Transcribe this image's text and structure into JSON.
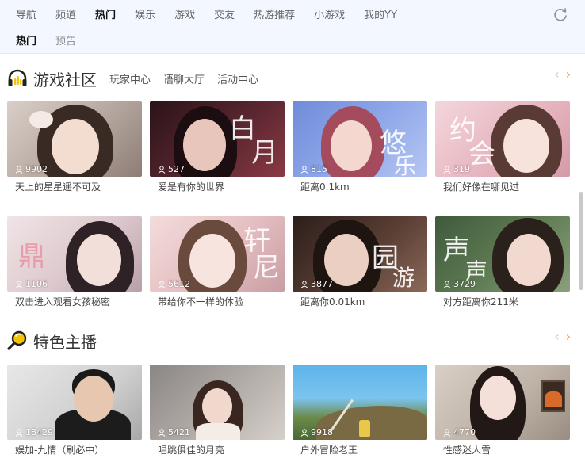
{
  "nav": {
    "tabs": [
      "导航",
      "频道",
      "热门",
      "娱乐",
      "游戏",
      "交友",
      "热游推荐",
      "小游戏",
      "我的YY"
    ],
    "active_tab": "热门",
    "subtabs": [
      "热门",
      "预告"
    ],
    "active_subtab": "热门"
  },
  "game_section": {
    "title": "游戏社区",
    "links": [
      "玩家中心",
      "语聊大厅",
      "活动中心"
    ],
    "cards": [
      {
        "viewers": "9902",
        "caption": "天上的星星遥不可及"
      },
      {
        "viewers": "527",
        "caption": "爱是有你的世界"
      },
      {
        "viewers": "815",
        "caption": "距离0.1km"
      },
      {
        "viewers": "319",
        "caption": "我们好像在哪见过"
      },
      {
        "viewers": "1106",
        "caption": "双击进入观看女孩秘密"
      },
      {
        "viewers": "5612",
        "caption": "带给你不一样的体验"
      },
      {
        "viewers": "3877",
        "caption": "距离你0.01km"
      },
      {
        "viewers": "3729",
        "caption": "对方距离你211米"
      }
    ]
  },
  "anchor_section": {
    "title": "特色主播",
    "cards": [
      {
        "viewers": "18429",
        "caption": "娱加-九情（刷必中）"
      },
      {
        "viewers": "5421",
        "caption": "唱跳俱佳的月亮"
      },
      {
        "viewers": "9918",
        "caption": "户外冒险老王"
      },
      {
        "viewers": "4770",
        "caption": "性感迷人雪"
      }
    ]
  },
  "thumb_overlay_text": [
    "白",
    "月",
    "悠",
    "乐",
    "约",
    "会",
    "鼎",
    "轩",
    "尼",
    "园",
    "游",
    "声",
    "声"
  ],
  "colors": {
    "accent": "#f0a04b",
    "nav_bg": "#f3f7ff",
    "pager_disabled": "#c8c8c8"
  }
}
